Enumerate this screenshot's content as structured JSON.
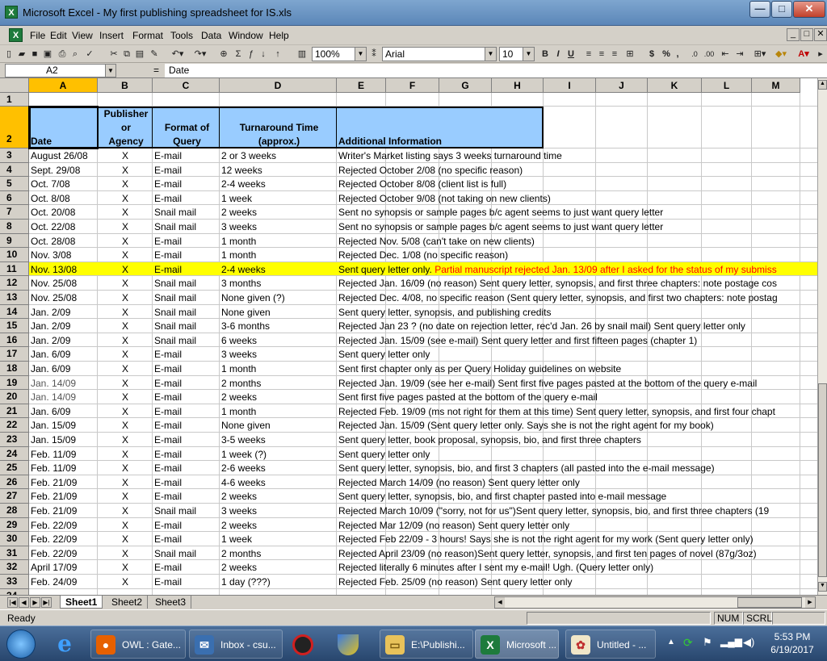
{
  "window": {
    "title": "Microsoft Excel - My first publishing spreadsheet for IS.xls",
    "minimize": "—",
    "maximize": "□",
    "close": "✕"
  },
  "menu": [
    "File",
    "Edit",
    "View",
    "Insert",
    "Format",
    "Tools",
    "Data",
    "Window",
    "Help"
  ],
  "menu_hotkeys": [
    "F",
    "E",
    "V",
    "I",
    "o",
    "T",
    "D",
    "W",
    "H"
  ],
  "doc_controls": [
    "_",
    "□",
    "✕"
  ],
  "toolbar": {
    "zoom": "100%",
    "font": "Arial",
    "size": "10",
    "bold": "B",
    "italic": "I",
    "underline": "U",
    "currency": "$",
    "percent": "%",
    "comma": ","
  },
  "formula": {
    "namebox": "A2",
    "eq": "=",
    "value": "Date"
  },
  "columns": [
    "A",
    "B",
    "C",
    "D",
    "E",
    "F",
    "G",
    "H",
    "I",
    "J",
    "K",
    "L",
    "M"
  ],
  "header_row": {
    "date": "Date",
    "publisher": [
      "Publisher",
      "or",
      "Agency"
    ],
    "format": [
      "Format of",
      "Query"
    ],
    "turnaround": [
      "Turnaround Time",
      "(approx.)"
    ],
    "info": "Additional Information"
  },
  "rows": [
    {
      "n": "1",
      "a": "",
      "b": "",
      "c": "",
      "d": "",
      "e": ""
    },
    {
      "n": "3",
      "a": "August 26/08",
      "b": "X",
      "c": "E-mail",
      "d": "2 or 3 weeks",
      "e": "Writer's Market listing says 3 weeks turnaround time"
    },
    {
      "n": "4",
      "a": "Sept. 29/08",
      "b": "X",
      "c": "E-mail",
      "d": "12 weeks",
      "e": "Rejected October 2/08 (no specific reason)"
    },
    {
      "n": "5",
      "a": "Oct. 7/08",
      "b": "X",
      "c": "E-mail",
      "d": "2-4 weeks",
      "e": "Rejected October 8/08 (client list is full)"
    },
    {
      "n": "6",
      "a": "Oct. 8/08",
      "b": "X",
      "c": "E-mail",
      "d": "1 week",
      "e": "Rejected October 9/08 (not taking on new clients)"
    },
    {
      "n": "7",
      "a": "Oct. 20/08",
      "b": "X",
      "c": "Snail mail",
      "d": "2 weeks",
      "e": "Sent no synopsis or sample pages b/c agent seems to just want query letter"
    },
    {
      "n": "8",
      "a": "Oct. 22/08",
      "b": "X",
      "c": "Snail mail",
      "d": "3 weeks",
      "e": "Sent no synopsis or sample pages b/c agent seems to just want query letter"
    },
    {
      "n": "9",
      "a": "Oct. 28/08",
      "b": "X",
      "c": "E-mail",
      "d": "1 month",
      "e": "Rejected Nov. 5/08 (can't take on new clients)"
    },
    {
      "n": "10",
      "a": "Nov. 3/08",
      "b": "X",
      "c": "E-mail",
      "d": "1 month",
      "e": "Rejected Dec. 1/08 (no specific reason)"
    },
    {
      "n": "11",
      "a": "Nov. 13/08",
      "b": "X",
      "c": "E-mail",
      "d": "2-4 weeks",
      "e": "Sent query letter only.",
      "e2": "Partial manuscript rejected Jan. 13/09 after I asked for the status of my submiss",
      "hl": true
    },
    {
      "n": "12",
      "a": "Nov. 25/08",
      "b": "X",
      "c": "Snail mail",
      "d": "3 months",
      "e": "Rejected Jan. 16/09 (no reason) Sent query letter, synopsis, and first three chapters: note postage cos"
    },
    {
      "n": "13",
      "a": "Nov. 25/08",
      "b": "X",
      "c": "Snail mail",
      "d": "None given (?)",
      "e": "Rejected Dec. 4/08, no specific reason (Sent query letter, synopsis, and first two chapters: note postag"
    },
    {
      "n": "14",
      "a": "Jan. 2/09",
      "b": "X",
      "c": "Snail mail",
      "d": "None given",
      "e": "Sent query letter, synopsis, and publishing credits"
    },
    {
      "n": "15",
      "a": "Jan. 2/09",
      "b": "X",
      "c": "Snail mail",
      "d": "3-6 months",
      "e": "Rejected Jan 23 ? (no date on rejection letter, rec'd Jan. 26 by snail mail) Sent query letter only"
    },
    {
      "n": "16",
      "a": "Jan. 2/09",
      "b": "X",
      "c": "Snail mail",
      "d": "6 weeks",
      "e": "Rejected Jan. 15/09 (see e-mail) Sent query letter and first fifteen pages (chapter 1)"
    },
    {
      "n": "17",
      "a": "Jan. 6/09",
      "b": "X",
      "c": "E-mail",
      "d": "3 weeks",
      "e": "Sent query letter only"
    },
    {
      "n": "18",
      "a": "Jan. 6/09",
      "b": "X",
      "c": "E-mail",
      "d": "1 month",
      "e": "Sent first chapter only as per Query Holiday guidelines on website"
    },
    {
      "n": "19",
      "a": "Jan. 14/09",
      "b": "X",
      "c": "E-mail",
      "d": "2 months",
      "e": "Rejected Jan. 19/09 (see her e-mail) Sent first five pages pasted at the bottom of the query e-mail"
    },
    {
      "n": "20",
      "a": "Jan. 14/09",
      "b": "X",
      "c": "E-mail",
      "d": "2 weeks",
      "e": "Sent first five pages pasted at the bottom of the query e-mail"
    },
    {
      "n": "21",
      "a": "Jan. 6/09",
      "b": "X",
      "c": "E-mail",
      "d": "1 month",
      "e": "Rejected Feb. 19/09 (ms not right for them at this time) Sent query letter, synopsis, and first four chapt"
    },
    {
      "n": "22",
      "a": "Jan. 15/09",
      "b": "X",
      "c": "E-mail",
      "d": "None given",
      "e": "Rejected Jan. 15/09 (Sent query letter only.  Says she is not the right agent for my book)"
    },
    {
      "n": "23",
      "a": "Jan. 15/09",
      "b": "X",
      "c": "E-mail",
      "d": "3-5 weeks",
      "e": "Sent query letter, book proposal, synopsis, bio, and first three chapters"
    },
    {
      "n": "24",
      "a": "Feb. 11/09",
      "b": "X",
      "c": "E-mail",
      "d": "1 week (?)",
      "e": "Sent query letter only"
    },
    {
      "n": "25",
      "a": "Feb. 11/09",
      "b": "X",
      "c": "E-mail",
      "d": "2-6 weeks",
      "e": "Sent query letter, synopsis, bio, and first 3 chapters (all pasted into the e-mail message)"
    },
    {
      "n": "26",
      "a": "Feb. 21/09",
      "b": "X",
      "c": "E-mail",
      "d": "4-6 weeks",
      "e": "Rejected March 14/09 (no reason) Sent query letter only"
    },
    {
      "n": "27",
      "a": "Feb. 21/09",
      "b": "X",
      "c": "E-mail",
      "d": "2 weeks",
      "e": "Sent query letter, synopsis, bio, and first chapter pasted into e-mail message"
    },
    {
      "n": "28",
      "a": "Feb. 21/09",
      "b": "X",
      "c": "Snail mail",
      "d": "3 weeks",
      "e": "Rejected March 10/09 (\"sorry, not for us\")Sent query letter, synopsis, bio, and first three chapters (19"
    },
    {
      "n": "29",
      "a": "Feb. 22/09",
      "b": "X",
      "c": "E-mail",
      "d": "2 weeks",
      "e": "Rejected Mar 12/09 (no reason) Sent query letter only"
    },
    {
      "n": "30",
      "a": "Feb. 22/09",
      "b": "X",
      "c": "E-mail",
      "d": "1 week",
      "e": "Rejected Feb 22/09 - 3 hours! Says she is not the right agent for my work (Sent query letter only)"
    },
    {
      "n": "31",
      "a": "Feb. 22/09",
      "b": "X",
      "c": "Snail mail",
      "d": "2 months",
      "e": "Rejected April 23/09 (no reason)Sent query letter, synopsis, and first ten pages of novel (87g/3oz)"
    },
    {
      "n": "32",
      "a": "April 17/09",
      "b": "X",
      "c": "E-mail",
      "d": "2 weeks",
      "e": "Rejected literally 6 minutes after I sent my e-mail!  Ugh.  (Query letter only)"
    },
    {
      "n": "33",
      "a": "Feb. 24/09",
      "b": "X",
      "c": "E-mail",
      "d": "1 day (???)",
      "e": "Rejected Feb. 25/09 (no reason) Sent query letter only"
    }
  ],
  "gray_dates": [
    "19",
    "20"
  ],
  "sheets": [
    "Sheet1",
    "Sheet2",
    "Sheet3"
  ],
  "status": {
    "ready": "Ready",
    "num": "NUM",
    "scrl": "SCRL"
  },
  "taskbar": {
    "items": [
      "OWL : Gate...",
      "Inbox - csu...",
      "E:\\Publishi...",
      "Microsoft ...",
      "Untitled - ..."
    ],
    "time": "5:53 PM",
    "date": "6/19/2017"
  },
  "colors": {
    "highlight": "#ffff00",
    "red_text": "#ff0000",
    "header_fill": "#99ccff",
    "selected_col": "#ffc000"
  }
}
